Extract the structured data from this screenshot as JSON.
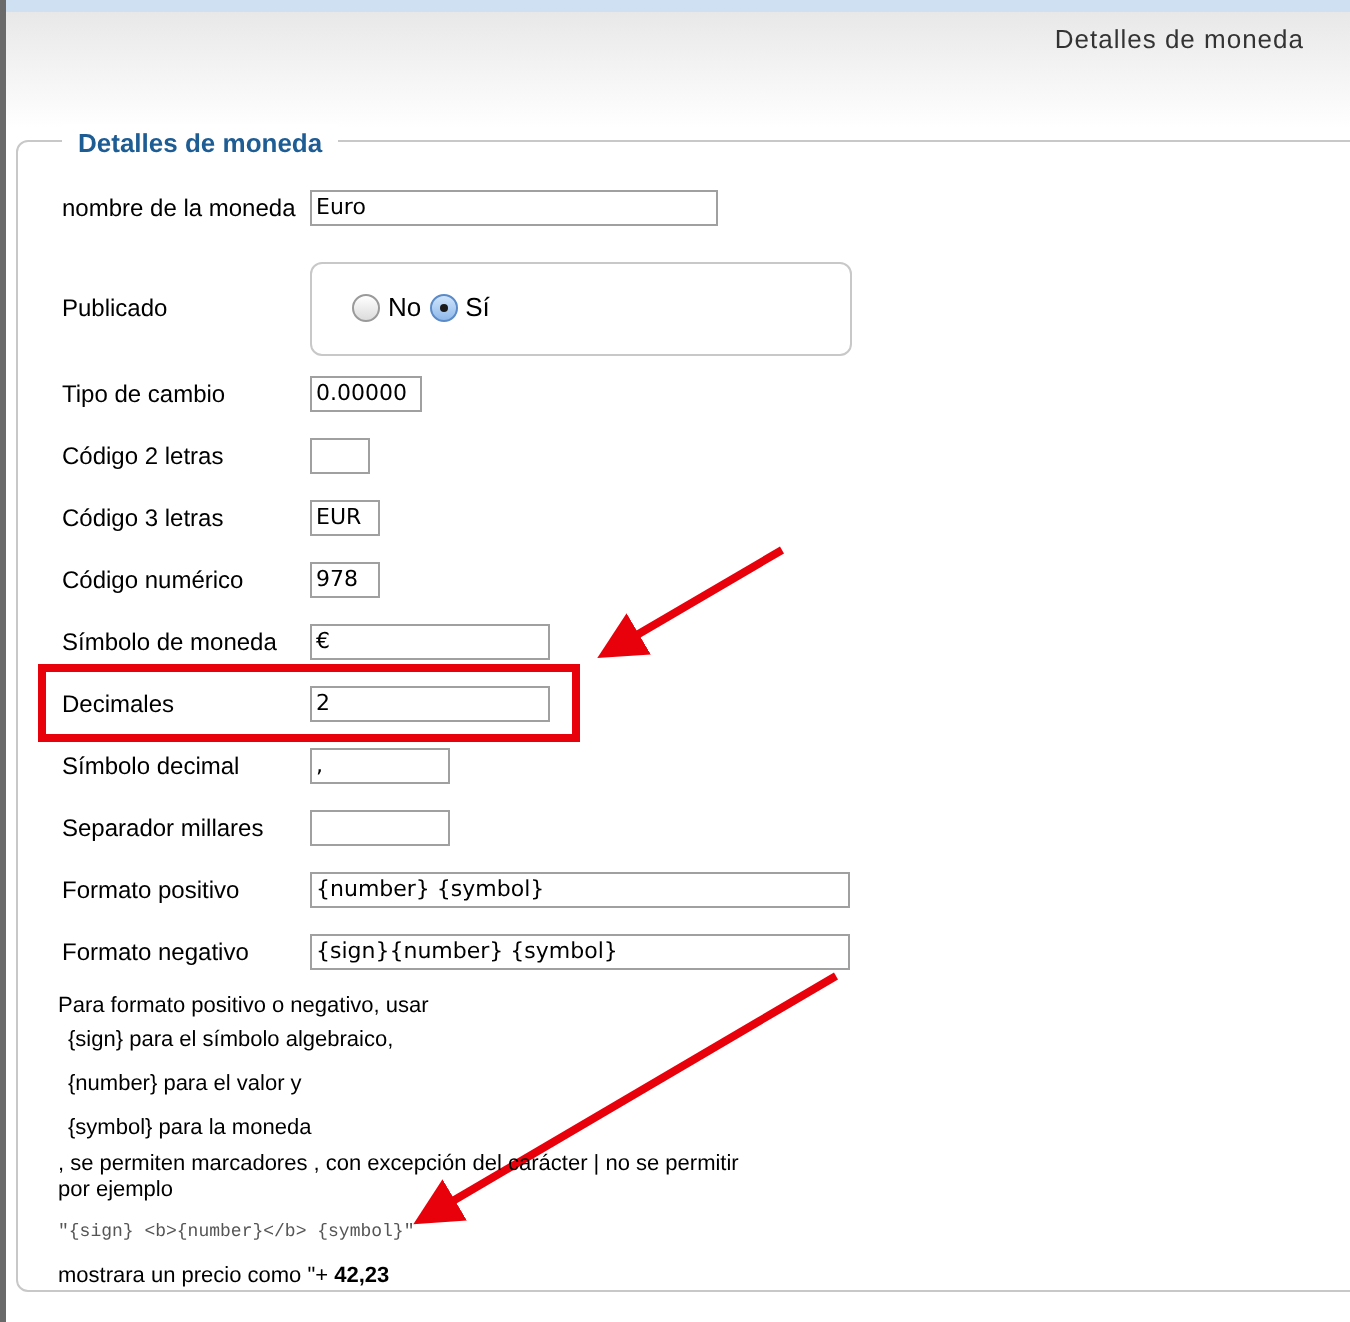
{
  "header": {
    "title": "Detalles de moneda"
  },
  "fieldset": {
    "legend": "Detalles de moneda"
  },
  "fields": [
    {
      "kind": "text",
      "label": "nombre de la moneda",
      "value": "Euro",
      "highlighted": false
    },
    {
      "kind": "radio",
      "label": "Publicado",
      "options": [
        {
          "label": "No",
          "selected": false
        },
        {
          "label": "Sí",
          "selected": true
        }
      ],
      "highlighted": false
    },
    {
      "kind": "text",
      "label": "Tipo de cambio",
      "value": "0.00000",
      "highlighted": false
    },
    {
      "kind": "text",
      "label": "Código 2 letras",
      "highlighted": false
    },
    {
      "kind": "text",
      "label": "Código 3 letras",
      "value": "EUR",
      "highlighted": false
    },
    {
      "kind": "text",
      "label": "Código numérico",
      "value": "978",
      "highlighted": false
    },
    {
      "kind": "text",
      "label": "Símbolo de moneda",
      "value": "€",
      "highlighted": false
    },
    {
      "kind": "text",
      "label": "Decimales",
      "value": "2",
      "highlighted": true
    },
    {
      "kind": "text",
      "label": "Símbolo decimal",
      "value": ",",
      "highlighted": false
    },
    {
      "kind": "text",
      "label": "Separador millares",
      "highlighted": false
    },
    {
      "kind": "text",
      "label": "Formato positivo",
      "value": "{number} {symbol}",
      "highlighted": false
    },
    {
      "kind": "text",
      "label": "Formato negativo",
      "value": "{sign}{number} {symbol}",
      "highlighted": false
    }
  ],
  "help": [
    {
      "kind": "plain",
      "text": "Para formato positivo o negativo, usar"
    },
    {
      "kind": "item",
      "text": "{sign} para el símbolo algebraico,"
    },
    {
      "kind": "item",
      "text": "{number} para el valor y"
    },
    {
      "kind": "item",
      "text": "{symbol} para la moneda"
    },
    {
      "kind": "plain",
      "text": ", se permiten marcadores , con excepción del carácter | no se permitir"
    },
    {
      "kind": "plain",
      "text": "por ejemplo"
    },
    {
      "kind": "code",
      "text": "\"{sign} <b>{number}</b> {symbol}\""
    },
    {
      "kind": "plain",
      "text": "mostrara un precio como \"+ **42,23**"
    }
  ]
}
